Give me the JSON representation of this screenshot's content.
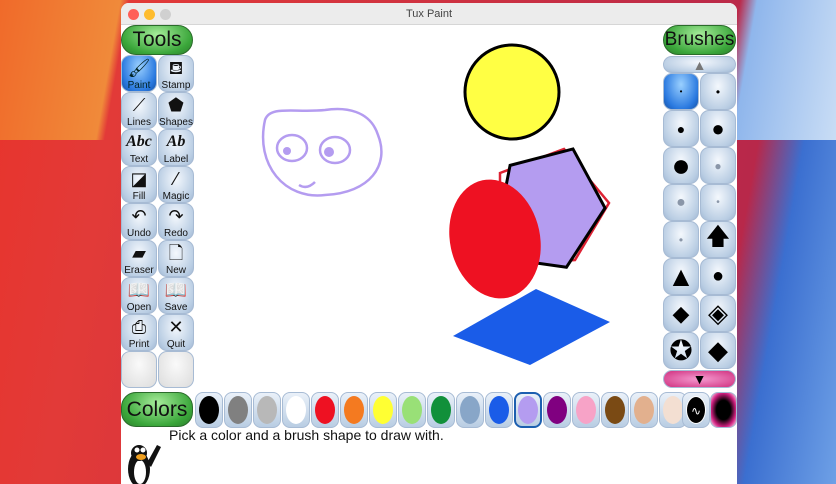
{
  "window": {
    "title": "Tux Paint"
  },
  "tools": {
    "header": "Tools",
    "items": [
      {
        "label": "Paint",
        "icon": "paintbrush-icon",
        "glyph": "🖌",
        "selected": true
      },
      {
        "label": "Stamp",
        "icon": "stamp-icon",
        "glyph": "⛾"
      },
      {
        "label": "Lines",
        "icon": "lines-icon",
        "glyph": "⟋"
      },
      {
        "label": "Shapes",
        "icon": "pentagon-icon",
        "glyph": "⬟"
      },
      {
        "label": "Text",
        "icon": "text-icon",
        "glyph": "Abc"
      },
      {
        "label": "Label",
        "icon": "label-icon",
        "glyph": "Ab"
      },
      {
        "label": "Fill",
        "icon": "paint-bucket-icon",
        "glyph": "◪"
      },
      {
        "label": "Magic",
        "icon": "magic-wand-icon",
        "glyph": "⁄"
      },
      {
        "label": "Undo",
        "icon": "undo-icon",
        "glyph": "↶"
      },
      {
        "label": "Redo",
        "icon": "redo-icon",
        "glyph": "↷"
      },
      {
        "label": "Eraser",
        "icon": "eraser-icon",
        "glyph": "▰"
      },
      {
        "label": "New",
        "icon": "new-file-icon",
        "glyph": "🗋"
      },
      {
        "label": "Open",
        "icon": "open-icon",
        "glyph": "📖"
      },
      {
        "label": "Save",
        "icon": "save-icon",
        "glyph": "📖"
      },
      {
        "label": "Print",
        "icon": "printer-icon",
        "glyph": "⎙"
      },
      {
        "label": "Quit",
        "icon": "quit-icon",
        "glyph": "✕"
      }
    ]
  },
  "brushes": {
    "header": "Brushes",
    "items": [
      {
        "icon": "brush-tiny-dot-icon",
        "glyph": "•",
        "size": 8,
        "selected": true
      },
      {
        "icon": "brush-small-dot-icon",
        "glyph": "•",
        "size": 12
      },
      {
        "icon": "brush-medium-dot-icon",
        "glyph": "●",
        "size": 14
      },
      {
        "icon": "brush-large-dot-icon",
        "glyph": "●",
        "size": 22
      },
      {
        "icon": "brush-xlarge-dot-icon",
        "glyph": "●",
        "size": 32
      },
      {
        "icon": "brush-fuzzy-dot-icon",
        "glyph": "●",
        "size": 12
      },
      {
        "icon": "brush-gray-dot-icon",
        "glyph": "●",
        "size": 16
      },
      {
        "icon": "brush-gray-small-dot-icon",
        "glyph": "•",
        "size": 10
      },
      {
        "icon": "brush-gray-tiny-dot-icon",
        "glyph": "•",
        "size": 12
      },
      {
        "icon": "brush-arrow-icon",
        "glyph": "🡅",
        "size": 24
      },
      {
        "icon": "brush-triangle-icon",
        "glyph": "▲",
        "size": 28
      },
      {
        "icon": "brush-circle-icon",
        "glyph": "●",
        "size": 20
      },
      {
        "icon": "brush-rhombus-icon",
        "glyph": "◆",
        "size": 22
      },
      {
        "icon": "brush-diamond-square-icon",
        "glyph": "◈",
        "size": 26
      },
      {
        "icon": "brush-star-icon",
        "glyph": "✪",
        "size": 28
      },
      {
        "icon": "brush-diamond-icon",
        "glyph": "◆",
        "size": 26
      }
    ]
  },
  "colors": {
    "header": "Colors",
    "swatches": [
      "#000000",
      "#808080",
      "#b8b8b8",
      "#ffffff",
      "#ee1122",
      "#f47a20",
      "#ffff33",
      "#99e077",
      "#11903a",
      "#88a6c8",
      "#1a5ce8",
      "#b49cf0",
      "#800080",
      "#f7a3c7",
      "#7a4a14",
      "#e2b08e",
      "#f3dfd2"
    ],
    "selected": 11
  },
  "status": {
    "message": "Pick a color and a brush shape to draw with."
  }
}
